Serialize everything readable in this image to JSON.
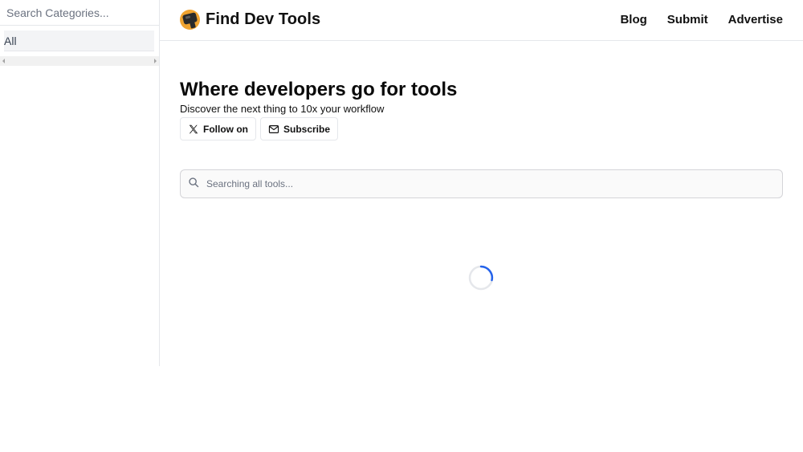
{
  "sidebar": {
    "search_placeholder": "Search Categories...",
    "items": [
      {
        "label": "All",
        "selected": true
      }
    ]
  },
  "header": {
    "brand": "Find Dev Tools",
    "logo_icon": "camera-icon",
    "nav": [
      {
        "label": "Blog"
      },
      {
        "label": "Submit"
      },
      {
        "label": "Advertise"
      }
    ]
  },
  "hero": {
    "title": "Where developers go for tools",
    "subtitle": "Discover the next thing to 10x your workflow",
    "follow_label": "Follow on",
    "follow_icon": "x-logo-icon",
    "subscribe_label": "Subscribe",
    "subscribe_icon": "mail-icon"
  },
  "search": {
    "placeholder": "Searching all tools...",
    "icon": "search-icon"
  },
  "status": {
    "loading": true,
    "spinner_color": "#2563eb"
  },
  "colors": {
    "accent": "#2563eb",
    "logo": "#f0a330",
    "border": "#e5e7eb"
  }
}
